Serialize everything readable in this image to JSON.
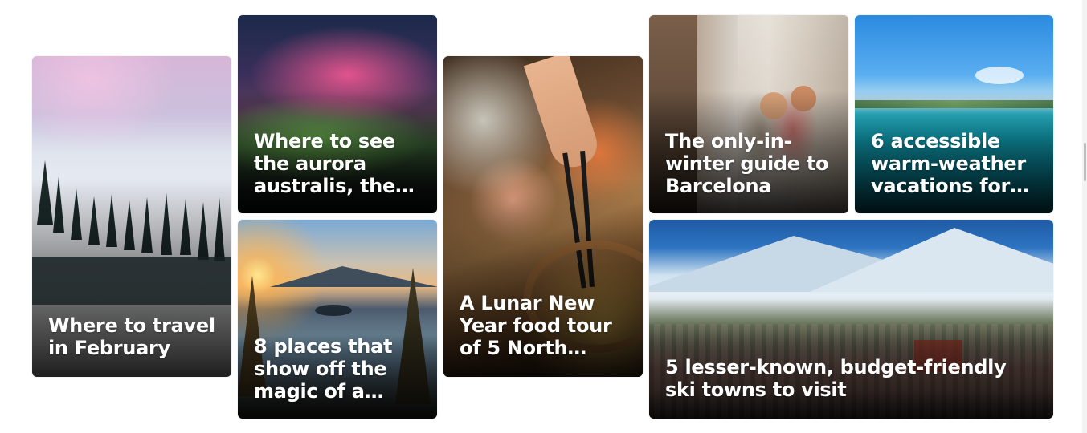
{
  "cards": [
    {
      "title": "Where to travel in February",
      "image": "snowy-mountain-ski-slope"
    },
    {
      "title": "Where to see the aurora australis, the…",
      "image": "aurora-night-sky"
    },
    {
      "title": "8 places that show off the magic of a…",
      "image": "lake-sunset-pines"
    },
    {
      "title": "A Lunar New Year food tour of 5 North…",
      "image": "dim-sum-chopsticks"
    },
    {
      "title": "The only-in-winter guide to Barcelona",
      "image": "barcelona-street-christmas"
    },
    {
      "title": "6 accessible warm-weather vacations for…",
      "image": "tropical-beach"
    },
    {
      "title": "5 lesser-known, budget-friendly ski towns to visit",
      "image": "snowy-mountain-town"
    }
  ]
}
